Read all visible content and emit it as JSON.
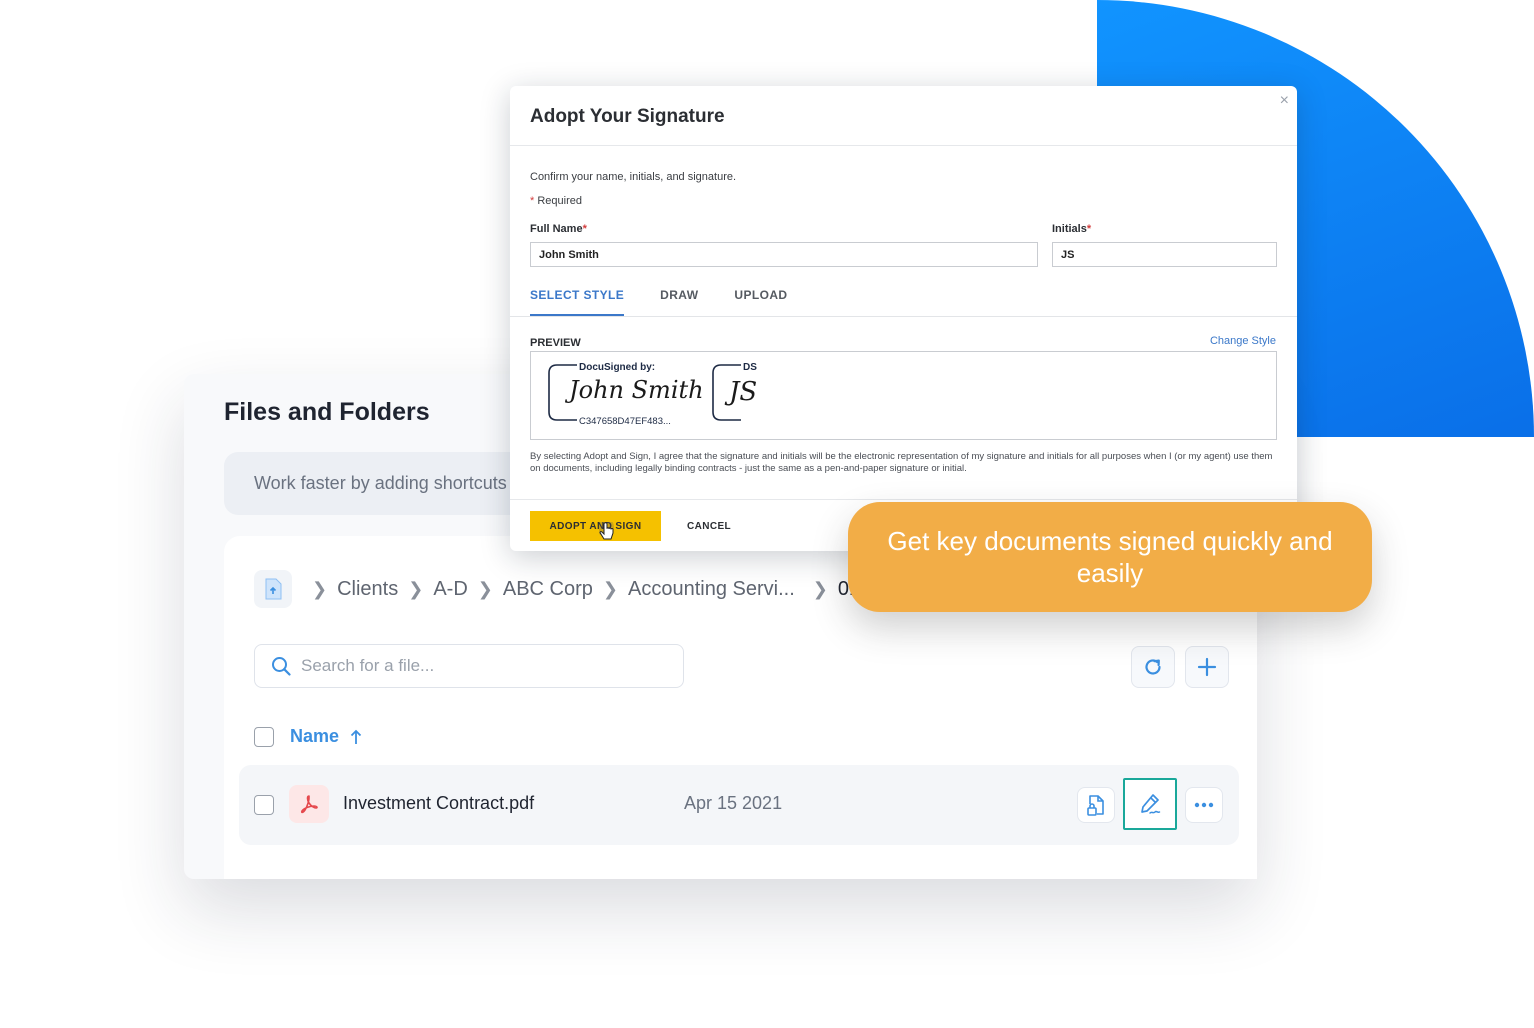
{
  "files": {
    "title": "Files and Folders",
    "shortcuts_text": "Work faster by adding shortcuts",
    "breadcrumb": [
      "Clients",
      "A-D",
      "ABC Corp",
      "Accounting Servi...",
      "01 -"
    ],
    "search_placeholder": "Search for a file...",
    "column_name": "Name",
    "rows": [
      {
        "name": "Investment Contract.pdf",
        "date": "Apr 15 2021"
      }
    ]
  },
  "dialog": {
    "title": "Adopt Your Signature",
    "close": "×",
    "instruction": "Confirm your name, initials, and signature.",
    "required_mark": "*",
    "required_label": "Required",
    "full_name_label": "Full Name",
    "full_name_value": "John Smith",
    "initials_label": "Initials",
    "initials_value": "JS",
    "tabs": [
      "SELECT STYLE",
      "DRAW",
      "UPLOAD"
    ],
    "preview_label": "PREVIEW",
    "change_style": "Change Style",
    "docusigned_by": "DocuSigned by:",
    "signature_script": "John Smith",
    "signature_id": "C347658D47EF483...",
    "ds_label": "DS",
    "initials_script": "JS",
    "legal_text": "By selecting Adopt and Sign, I agree that the signature and initials will be the electronic representation of my signature and initials for all purposes when I (or my agent) use them on documents, including legally binding contracts - just the same as a pen-and-paper signature or initial.",
    "adopt_button": "ADOPT AND SIGN",
    "cancel_button": "CANCEL"
  },
  "callout": {
    "text": "Get key documents signed quickly and easily"
  },
  "colors": {
    "accent_blue": "#0a6fe8",
    "callout_orange": "#f2ad47",
    "adopt_yellow": "#f5c100",
    "highlight_teal": "#1aa89a"
  }
}
